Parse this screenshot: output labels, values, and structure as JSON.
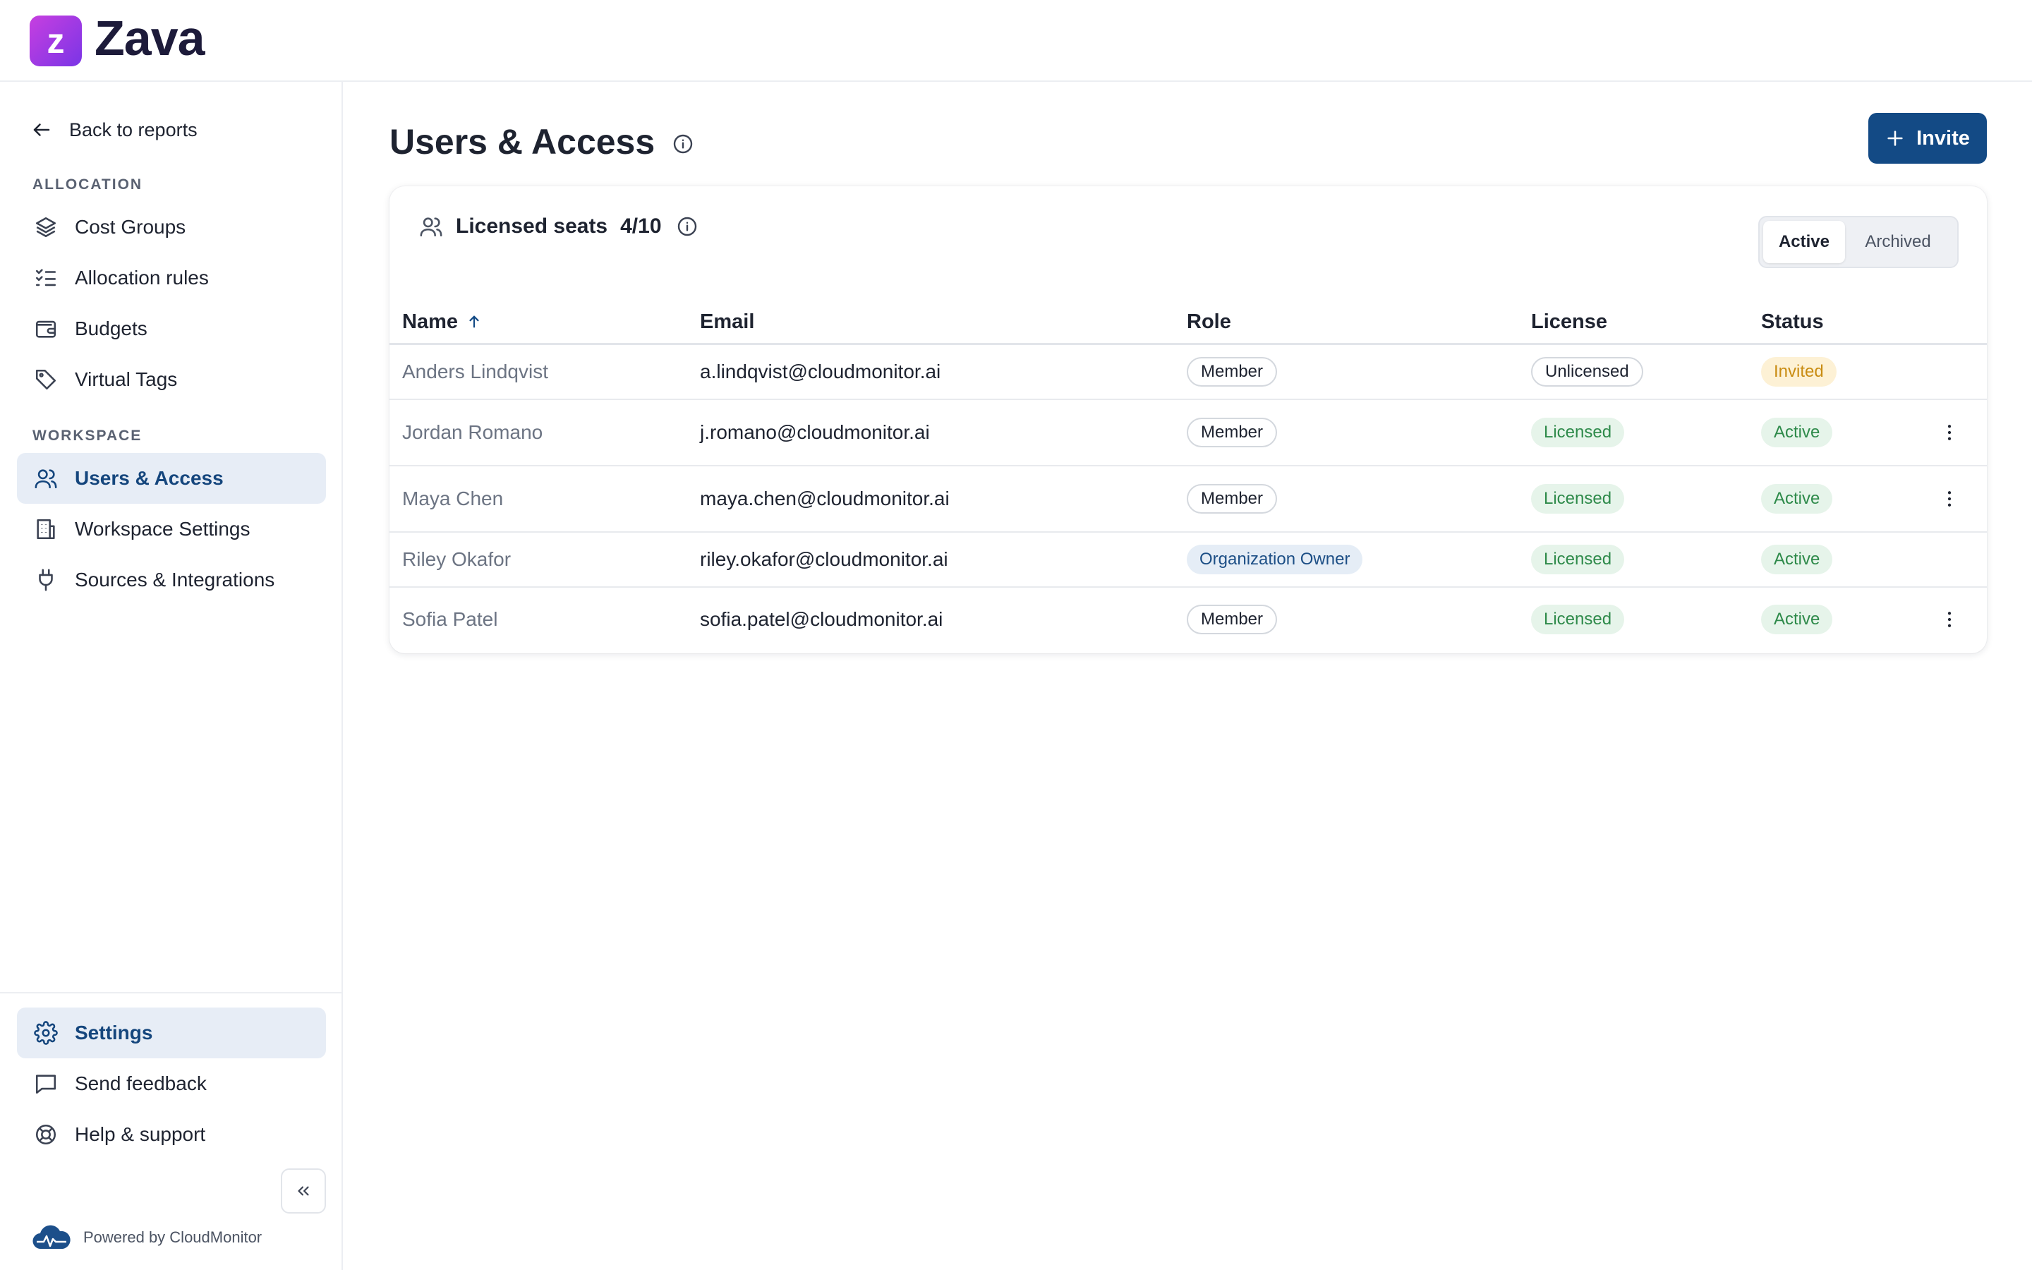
{
  "app": {
    "name": "Zava",
    "logo_letter": "z"
  },
  "sidebar": {
    "back_label": "Back to reports",
    "sections": [
      {
        "label": "ALLOCATION"
      },
      {
        "label": "WORKSPACE"
      }
    ],
    "items": [
      {
        "label": "Cost Groups",
        "icon": "layers-icon"
      },
      {
        "label": "Allocation rules",
        "icon": "list-checks-icon"
      },
      {
        "label": "Budgets",
        "icon": "wallet-icon"
      },
      {
        "label": "Virtual Tags",
        "icon": "tag-icon"
      },
      {
        "label": "Users & Access",
        "icon": "users-icon",
        "active": true
      },
      {
        "label": "Workspace Settings",
        "icon": "building-icon"
      },
      {
        "label": "Sources & Integrations",
        "icon": "plug-icon"
      }
    ],
    "footer_items": [
      {
        "label": "Settings",
        "icon": "gear-icon",
        "active": true
      },
      {
        "label": "Send feedback",
        "icon": "message-square-icon"
      },
      {
        "label": "Help & support",
        "icon": "life-buoy-icon"
      }
    ],
    "powered_by": "Powered by CloudMonitor"
  },
  "page": {
    "title": "Users & Access",
    "invite_label": "Invite"
  },
  "seats": {
    "label": "Licensed seats",
    "count": "4/10"
  },
  "filter": {
    "options": [
      "Active",
      "Archived"
    ],
    "selected": "Active"
  },
  "table": {
    "columns": [
      "Name",
      "Email",
      "Role",
      "License",
      "Status"
    ],
    "sort_column": "Name",
    "sort_direction": "ascending",
    "rows": [
      {
        "name": "Anders Lindqvist",
        "email": "a.lindqvist@cloudmonitor.ai",
        "role": "Member",
        "license": "Unlicensed",
        "status": "Invited",
        "has_menu": false
      },
      {
        "name": "Jordan Romano",
        "email": "j.romano@cloudmonitor.ai",
        "role": "Member",
        "license": "Licensed",
        "status": "Active",
        "has_menu": true
      },
      {
        "name": "Maya Chen",
        "email": "maya.chen@cloudmonitor.ai",
        "role": "Member",
        "license": "Licensed",
        "status": "Active",
        "has_menu": true
      },
      {
        "name": "Riley Okafor",
        "email": "riley.okafor@cloudmonitor.ai",
        "role": "Organization Owner",
        "license": "Licensed",
        "status": "Active",
        "has_menu": false
      },
      {
        "name": "Sofia Patel",
        "email": "sofia.patel@cloudmonitor.ai",
        "role": "Member",
        "license": "Licensed",
        "status": "Active",
        "has_menu": true
      }
    ]
  },
  "colors": {
    "brand_gradient_start": "#c73fe0",
    "brand_gradient_end": "#7a35e6",
    "primary": "#134a85",
    "active_nav_bg": "#e7edf6",
    "success": "#2e8a4a",
    "warning": "#c98c12"
  }
}
